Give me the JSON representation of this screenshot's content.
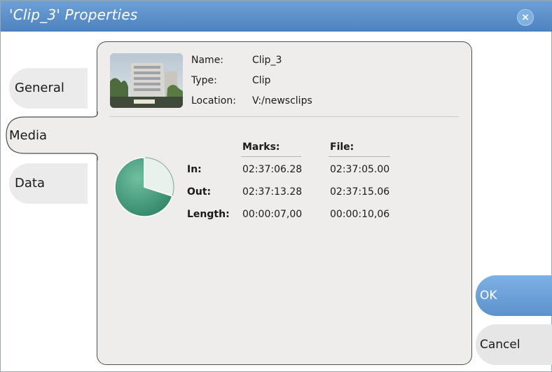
{
  "window": {
    "title": "'Clip_3' Properties",
    "close_symbol": "×",
    "titlebar_color": "#5a8ec8"
  },
  "tabs": [
    {
      "label": "General",
      "selected": false
    },
    {
      "label": "Media",
      "selected": true
    },
    {
      "label": "Data",
      "selected": false
    }
  ],
  "clip_info": {
    "name_label": "Name:",
    "name_value": "Clip_3",
    "type_label": "Type:",
    "type_value": "Clip",
    "location_label": "Location:",
    "location_value": "V:/newsclips"
  },
  "timing": {
    "marks_header": "Marks:",
    "file_header": "File:",
    "rows": [
      {
        "label": "In:",
        "marks": "02:37:06.28",
        "file": "02:37:05.00"
      },
      {
        "label": "Out:",
        "marks": "02:37:13.28",
        "file": "02:37:15.06"
      },
      {
        "label": "Length:",
        "marks": "00:00:07,00",
        "file": "00:00:10,06"
      }
    ]
  },
  "pie": {
    "marked_fraction": 0.7,
    "fill_color": "#3e9a79",
    "unmarked_color": "#e9f1ed"
  },
  "buttons": {
    "ok": "OK",
    "cancel": "Cancel",
    "ok_color": "#5c92cc"
  },
  "icons": {
    "close": "close-icon",
    "thumbnail": "clip-thumbnail",
    "pie": "marks-pie-chart"
  }
}
